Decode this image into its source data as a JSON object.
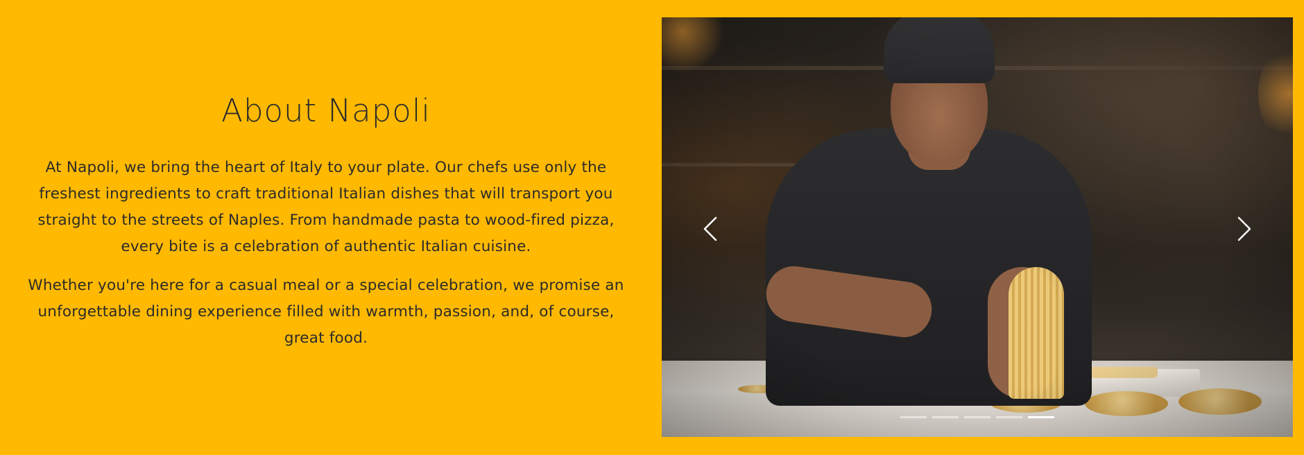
{
  "about": {
    "title": "About Napoli",
    "paragraphs": [
      "At Napoli, we bring the heart of Italy to your plate. Our chefs use only the freshest ingredients to craft traditional Italian dishes that will transport you straight to the streets of Naples. From handmade pasta to wood-fired pizza, every bite is a celebration of authentic Italian cuisine.",
      "Whether you're here for a casual meal or a special celebration, we promise an unforgettable dining experience filled with warmth, passion, and, of course, great food."
    ]
  },
  "carousel": {
    "slide_count": 5,
    "active_index": 4,
    "prev_icon": "chevron-left-icon",
    "next_icon": "chevron-right-icon",
    "slide_description_icon": "chef-making-pasta-photo"
  },
  "colors": {
    "background": "#FFB900",
    "text": "#2b2b2b",
    "arrow": "#ffffff"
  }
}
